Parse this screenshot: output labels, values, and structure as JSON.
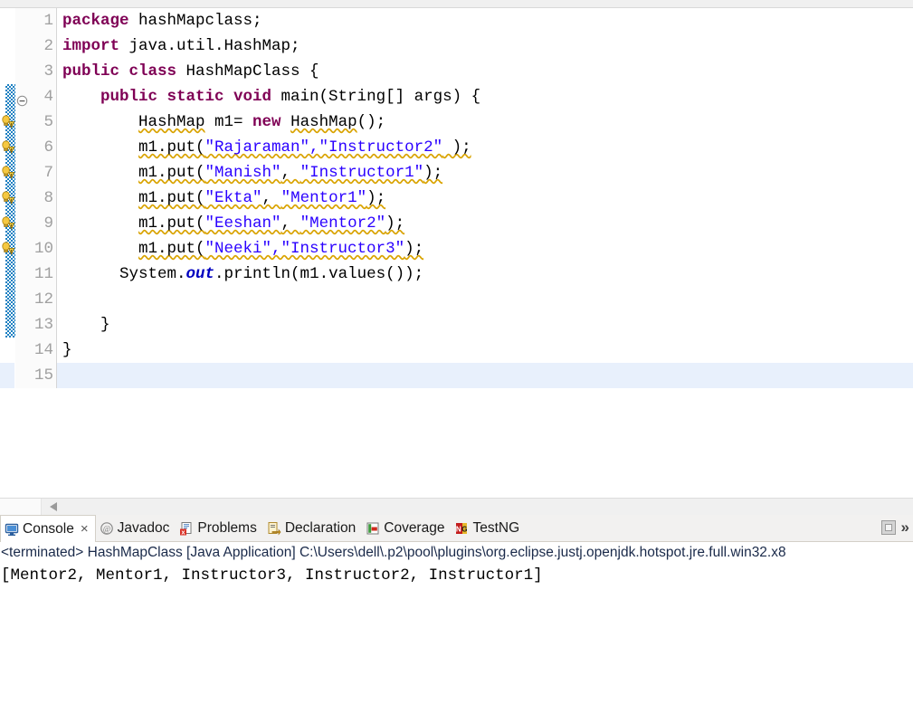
{
  "editor": {
    "language": "java",
    "current_line": 15,
    "lines": [
      {
        "no": 1,
        "warn": false,
        "change": false,
        "fold": false,
        "tokens": [
          {
            "t": "package",
            "c": "kw"
          },
          {
            "t": " hashMapclass;",
            "c": ""
          }
        ]
      },
      {
        "no": 2,
        "warn": false,
        "change": false,
        "fold": false,
        "tokens": [
          {
            "t": "import",
            "c": "kw"
          },
          {
            "t": " java.util.HashMap;",
            "c": ""
          }
        ]
      },
      {
        "no": 3,
        "warn": false,
        "change": false,
        "fold": false,
        "tokens": [
          {
            "t": "public class",
            "c": "kw"
          },
          {
            "t": " HashMapClass {",
            "c": ""
          }
        ]
      },
      {
        "no": 4,
        "warn": false,
        "change": true,
        "fold": true,
        "tokens": [
          {
            "t": "    ",
            "c": ""
          },
          {
            "t": "public static void",
            "c": "kw"
          },
          {
            "t": " main(String[] args) {",
            "c": ""
          }
        ]
      },
      {
        "no": 5,
        "warn": true,
        "change": true,
        "fold": false,
        "tokens": [
          {
            "t": "        ",
            "c": ""
          },
          {
            "t": "HashMap",
            "c": "sq"
          },
          {
            "t": " m1= ",
            "c": ""
          },
          {
            "t": "new",
            "c": "kw"
          },
          {
            "t": " ",
            "c": ""
          },
          {
            "t": "HashMap",
            "c": "sq"
          },
          {
            "t": "();",
            "c": ""
          }
        ]
      },
      {
        "no": 6,
        "warn": true,
        "change": true,
        "fold": false,
        "tokens": [
          {
            "t": "        ",
            "c": ""
          },
          {
            "t": "m1.put(",
            "c": "sq"
          },
          {
            "t": "\"Rajaraman\",\"Instructor2\"",
            "c": "str sq"
          },
          {
            "t": " );",
            "c": "sq"
          }
        ]
      },
      {
        "no": 7,
        "warn": true,
        "change": true,
        "fold": false,
        "tokens": [
          {
            "t": "        ",
            "c": ""
          },
          {
            "t": "m1.put(",
            "c": "sq"
          },
          {
            "t": "\"Manish\"",
            "c": "str sq"
          },
          {
            "t": ", ",
            "c": "sq"
          },
          {
            "t": "\"Instructor1\"",
            "c": "str sq"
          },
          {
            "t": ");",
            "c": "sq"
          }
        ]
      },
      {
        "no": 8,
        "warn": true,
        "change": true,
        "fold": false,
        "tokens": [
          {
            "t": "        ",
            "c": ""
          },
          {
            "t": "m1.put(",
            "c": "sq"
          },
          {
            "t": "\"Ekta\"",
            "c": "str sq"
          },
          {
            "t": ", ",
            "c": "sq"
          },
          {
            "t": "\"Mentor1\"",
            "c": "str sq"
          },
          {
            "t": ");",
            "c": "sq"
          }
        ]
      },
      {
        "no": 9,
        "warn": true,
        "change": true,
        "fold": false,
        "tokens": [
          {
            "t": "        ",
            "c": ""
          },
          {
            "t": "m1.put(",
            "c": "sq"
          },
          {
            "t": "\"Eeshan\"",
            "c": "str sq"
          },
          {
            "t": ", ",
            "c": "sq"
          },
          {
            "t": "\"Mentor2\"",
            "c": "str sq"
          },
          {
            "t": ");",
            "c": "sq"
          }
        ]
      },
      {
        "no": 10,
        "warn": true,
        "change": true,
        "fold": false,
        "tokens": [
          {
            "t": "        ",
            "c": ""
          },
          {
            "t": "m1.put(",
            "c": "sq"
          },
          {
            "t": "\"Neeki\",\"Instructor3\"",
            "c": "str sq"
          },
          {
            "t": ");",
            "c": "sq"
          }
        ]
      },
      {
        "no": 11,
        "warn": false,
        "change": true,
        "fold": false,
        "tokens": [
          {
            "t": "      System.",
            "c": ""
          },
          {
            "t": "out",
            "c": "fld"
          },
          {
            "t": ".println(m1.values());",
            "c": ""
          }
        ]
      },
      {
        "no": 12,
        "warn": false,
        "change": true,
        "fold": false,
        "tokens": [
          {
            "t": "",
            "c": ""
          }
        ]
      },
      {
        "no": 13,
        "warn": false,
        "change": true,
        "fold": false,
        "tokens": [
          {
            "t": "    }",
            "c": ""
          }
        ]
      },
      {
        "no": 14,
        "warn": false,
        "change": false,
        "fold": false,
        "tokens": [
          {
            "t": "}",
            "c": ""
          }
        ]
      },
      {
        "no": 15,
        "warn": false,
        "change": false,
        "fold": false,
        "tokens": [
          {
            "t": "",
            "c": ""
          }
        ]
      }
    ]
  },
  "console": {
    "tabs": [
      {
        "label": "Console",
        "icon": "console-icon",
        "active": true,
        "closable": true
      },
      {
        "label": "Javadoc",
        "icon": "javadoc-icon",
        "active": false,
        "closable": false
      },
      {
        "label": "Problems",
        "icon": "problems-icon",
        "active": false,
        "closable": false
      },
      {
        "label": "Declaration",
        "icon": "declaration-icon",
        "active": false,
        "closable": false
      },
      {
        "label": "Coverage",
        "icon": "coverage-icon",
        "active": false,
        "closable": false
      },
      {
        "label": "TestNG",
        "icon": "testng-icon",
        "active": false,
        "closable": false
      }
    ],
    "close_glyph": "×",
    "chevron_glyph": "»",
    "process_line": "<terminated> HashMapClass [Java Application] C:\\Users\\dell\\.p2\\pool\\plugins\\org.eclipse.justj.openjdk.hotspot.jre.full.win32.x8",
    "output": "[Mentor2, Mentor1, Instructor3, Instructor2, Instructor1]"
  },
  "colors": {
    "keyword": "#7f0055",
    "string": "#2a00ff",
    "static_field": "#0000c0",
    "warning_squiggle": "#d9a300",
    "change_bar": "#1a7fc1",
    "current_line": "#e8f0fc"
  }
}
